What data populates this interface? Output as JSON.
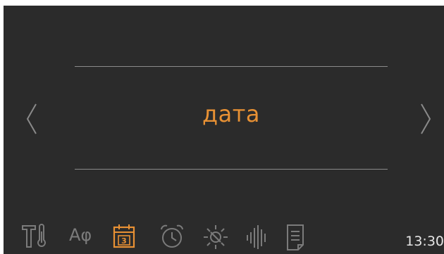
{
  "menu": {
    "title": "дата"
  },
  "nav": {
    "prev_icon": "chevron-left-icon",
    "next_icon": "chevron-right-icon"
  },
  "bottom_bar": {
    "items": [
      {
        "icon": "tools-thermometer-icon",
        "active": false
      },
      {
        "icon": "language-icon",
        "label": "Aφ",
        "active": false
      },
      {
        "icon": "calendar-icon",
        "day": "3",
        "active": true
      },
      {
        "icon": "alarm-clock-icon",
        "active": false
      },
      {
        "icon": "brightness-icon",
        "active": false
      },
      {
        "icon": "sound-icon",
        "active": false
      },
      {
        "icon": "document-icon",
        "active": false
      }
    ],
    "time": "13:30"
  },
  "colors": {
    "background": "#2b2b2b",
    "accent": "#e89134",
    "inactive_icon": "#7b7b7b",
    "rule": "#8a8a8a",
    "text": "#e6e6e6"
  }
}
